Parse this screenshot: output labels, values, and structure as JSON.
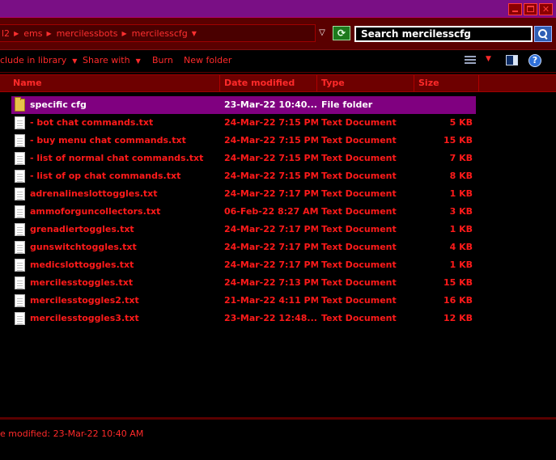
{
  "window": {
    "controls": {
      "minimize": "",
      "maximize": "",
      "close": "✕"
    }
  },
  "address": {
    "breadcrumbs": [
      "l2",
      "ems",
      "mercilessbots",
      "mercilesscfg"
    ],
    "search_value": "Search mercilesscfg"
  },
  "toolbar": {
    "include_in_library": "clude in library",
    "share_with": "Share with",
    "burn": "Burn",
    "new_folder": "New folder"
  },
  "columns": {
    "name": "Name",
    "date_modified": "Date modified",
    "type": "Type",
    "size": "Size"
  },
  "files": [
    {
      "name": "specific cfg",
      "date": "23-Mar-22 10:40...",
      "type": "File folder",
      "size": "",
      "icon": "folder-icon",
      "selected": true
    },
    {
      "name": "- bot chat commands.txt",
      "date": "24-Mar-22 7:15 PM",
      "type": "Text Document",
      "size": "5 KB",
      "icon": "text-file-icon"
    },
    {
      "name": "- buy menu chat commands.txt",
      "date": "24-Mar-22 7:15 PM",
      "type": "Text Document",
      "size": "15 KB",
      "icon": "text-file-icon"
    },
    {
      "name": "- list of normal chat commands.txt",
      "date": "24-Mar-22 7:15 PM",
      "type": "Text Document",
      "size": "7 KB",
      "icon": "text-file-icon"
    },
    {
      "name": "- list of op chat commands.txt",
      "date": "24-Mar-22 7:15 PM",
      "type": "Text Document",
      "size": "8 KB",
      "icon": "text-file-icon"
    },
    {
      "name": "adrenalineslottoggles.txt",
      "date": "24-Mar-22 7:17 PM",
      "type": "Text Document",
      "size": "1 KB",
      "icon": "text-file-icon"
    },
    {
      "name": "ammoforguncollectors.txt",
      "date": "06-Feb-22 8:27 AM",
      "type": "Text Document",
      "size": "3 KB",
      "icon": "text-file-icon"
    },
    {
      "name": "grenadiertoggles.txt",
      "date": "24-Mar-22 7:17 PM",
      "type": "Text Document",
      "size": "1 KB",
      "icon": "text-file-icon"
    },
    {
      "name": "gunswitchtoggles.txt",
      "date": "24-Mar-22 7:17 PM",
      "type": "Text Document",
      "size": "4 KB",
      "icon": "text-file-icon"
    },
    {
      "name": "medicslottoggles.txt",
      "date": "24-Mar-22 7:17 PM",
      "type": "Text Document",
      "size": "1 KB",
      "icon": "text-file-icon"
    },
    {
      "name": "mercilesstoggles.txt",
      "date": "24-Mar-22 7:13 PM",
      "type": "Text Document",
      "size": "15 KB",
      "icon": "text-file-icon"
    },
    {
      "name": "mercilesstoggles2.txt",
      "date": "21-Mar-22 4:11 PM",
      "type": "Text Document",
      "size": "16 KB",
      "icon": "text-file-icon"
    },
    {
      "name": "mercilesstoggles3.txt",
      "date": "23-Mar-22 12:48...",
      "type": "Text Document",
      "size": "12 KB",
      "icon": "text-file-icon"
    }
  ],
  "status": {
    "text": "e modified: 23-Mar-22 10:40 AM"
  },
  "colors": {
    "accent": "#ff1a1a",
    "title_bar": "#7a0f85",
    "selection": "#800080",
    "header_bg": "#6e0000"
  }
}
